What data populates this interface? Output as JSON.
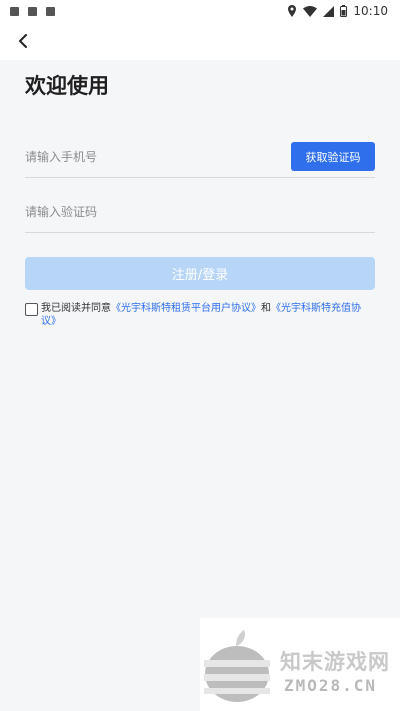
{
  "status_bar": {
    "time": "10:10",
    "left_icons": [
      "notification-icon-1",
      "notification-icon-2",
      "notification-icon-3"
    ],
    "right_icons": [
      "location-icon",
      "wifi-icon",
      "signal-icon",
      "battery-icon"
    ]
  },
  "header": {
    "back_icon": "chevron-left-icon"
  },
  "page": {
    "title": "欢迎使用",
    "phone_placeholder": "请输入手机号",
    "get_code_label": "获取验证码",
    "code_placeholder": "请输入验证码",
    "submit_label": "注册/登录",
    "agreement": {
      "prefix": "我已阅读并同意",
      "link1": "《光宇科斯特租赁平台用户协议》",
      "connector": "和",
      "link2": "《光宇科斯特充值协议》"
    }
  },
  "watermark": {
    "title": "知末游戏网",
    "url": "ZMO28.CN"
  },
  "colors": {
    "accent": "#2f6fec",
    "submit_disabled": "#b7d6f7",
    "background": "#f5f6f8",
    "link": "#2f6fec"
  }
}
